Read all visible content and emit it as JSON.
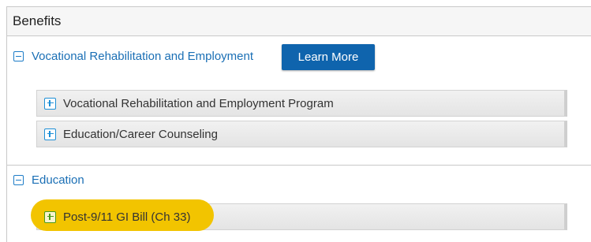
{
  "panel": {
    "title": "Benefits"
  },
  "sections": [
    {
      "title": "Vocational Rehabilitation and Employment",
      "button_label": "Learn More",
      "items": [
        {
          "label": "Vocational Rehabilitation and Employment Program"
        },
        {
          "label": "Education/Career Counseling"
        }
      ]
    },
    {
      "title": "Education",
      "items": [
        {
          "label": "Post-9/11 GI Bill (Ch 33)",
          "highlighted": true
        }
      ]
    }
  ],
  "colors": {
    "link": "#1a6fb5",
    "button": "#0f64ad",
    "highlight": "#f2c400"
  },
  "icons": {
    "expanded": "minus-box-icon",
    "collapsed": "plus-box-icon"
  }
}
